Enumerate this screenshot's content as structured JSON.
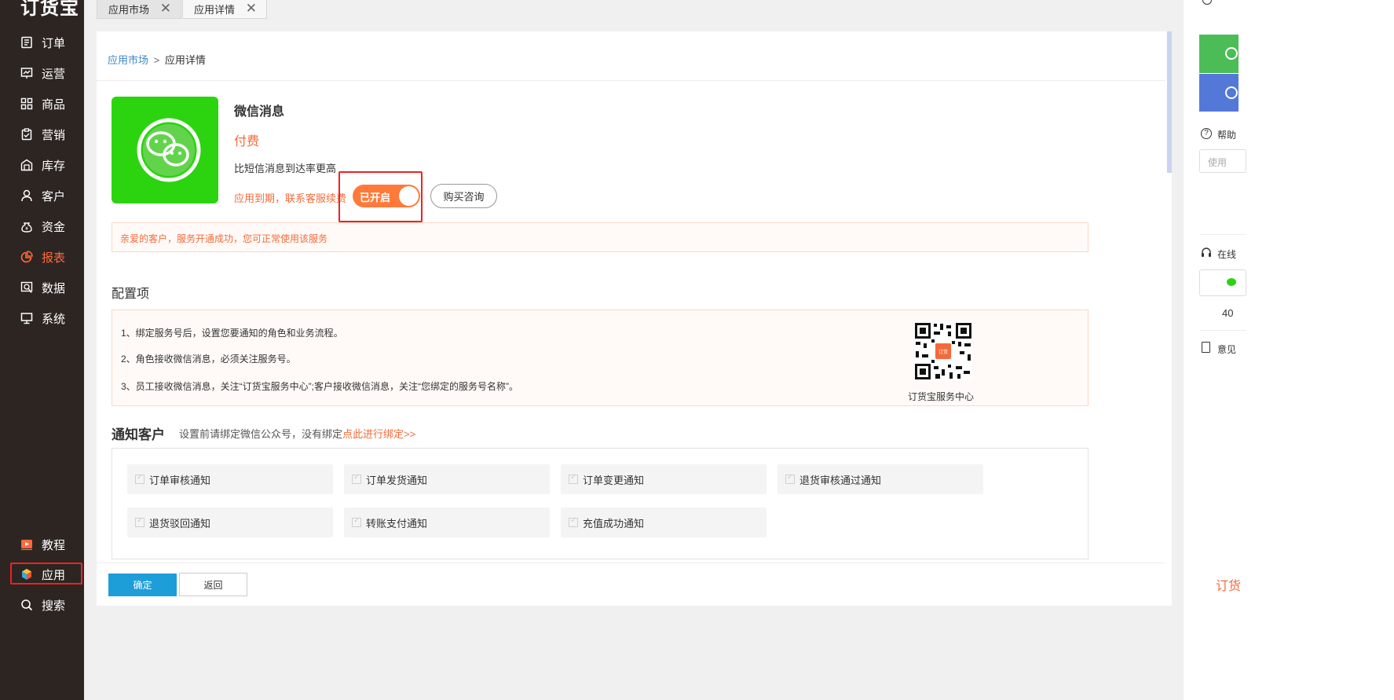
{
  "brand": "订货宝",
  "sidebar": {
    "items": [
      {
        "label": "订单",
        "icon": "order-icon"
      },
      {
        "label": "运营",
        "icon": "operation-chart-icon"
      },
      {
        "label": "商品",
        "icon": "grid-icon"
      },
      {
        "label": "营销",
        "icon": "clipboard-icon"
      },
      {
        "label": "库存",
        "icon": "warehouse-icon"
      },
      {
        "label": "客户",
        "icon": "user-icon"
      },
      {
        "label": "资金",
        "icon": "money-bag-icon"
      },
      {
        "label": "报表",
        "icon": "pie-chart-icon",
        "active": true
      },
      {
        "label": "数据",
        "icon": "data-icon"
      },
      {
        "label": "系统",
        "icon": "monitor-icon"
      }
    ],
    "bottom_items": [
      {
        "label": "教程",
        "icon": "play-icon"
      },
      {
        "label": "应用",
        "icon": "cube-icon"
      },
      {
        "label": "搜索",
        "icon": "search-icon"
      }
    ]
  },
  "tabs": [
    {
      "label": "应用市场",
      "close": "✕"
    },
    {
      "label": "应用详情",
      "close": "✕"
    }
  ],
  "breadcrumb": {
    "root": "应用市场",
    "separator": ">",
    "current": "应用详情"
  },
  "app": {
    "name": "微信消息",
    "price": "付费",
    "description": "比短信消息到达率更高",
    "expire_note": "应用到期，联系客服续费",
    "toggle_label": "已开启",
    "toggle_on": true,
    "consult_label": "购买咨询"
  },
  "notice": "亲爱的客户，服务开通成功，您可正常使用该服务",
  "config": {
    "title": "配置项",
    "lines": [
      "1、绑定服务号后，设置您要通知的角色和业务流程。",
      "2、角色接收微信消息，必须关注服务号。",
      "3、员工接收微信消息，关注“订货宝服务中心”;客户接收微信消息，关注“您绑定的服务号名称”。"
    ],
    "qr_caption": "订货宝服务中心"
  },
  "notify": {
    "title": "通知客户",
    "subtitle": "设置前请绑定微信公众号，没有绑定",
    "link": "点此进行绑定>>",
    "options": [
      {
        "label": "订单审核通知",
        "checked": true
      },
      {
        "label": "订单发货通知",
        "checked": true
      },
      {
        "label": "订单变更通知",
        "checked": true
      },
      {
        "label": "退货审核通过通知",
        "checked": true
      },
      {
        "label": "退货驳回通知",
        "checked": true
      },
      {
        "label": "转账支付通知",
        "checked": true
      },
      {
        "label": "充值成功通知",
        "checked": true
      }
    ]
  },
  "footer": {
    "ok": "确定",
    "back": "返回"
  },
  "right_panel": {
    "help": "帮助",
    "search_placeholder": "使用",
    "online": "在线",
    "phone": "40",
    "feedback": "意见",
    "brand": "订货"
  },
  "colors": {
    "accent": "#ff7a3a",
    "primary": "#1e9ed8",
    "sidebar": "#2d2522",
    "app_icon": "#2bd40f"
  }
}
